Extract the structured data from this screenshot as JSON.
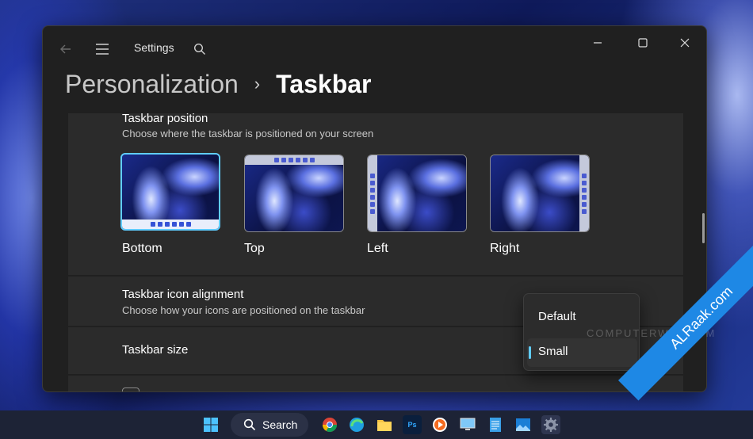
{
  "app": {
    "title": "Settings"
  },
  "breadcrumb": {
    "parent": "Personalization",
    "separator": "›",
    "current": "Taskbar"
  },
  "taskbar_position": {
    "title": "Taskbar position",
    "description": "Choose where the taskbar is positioned on your screen",
    "options": [
      {
        "label": "Bottom",
        "selected": true
      },
      {
        "label": "Top",
        "selected": false
      },
      {
        "label": "Left",
        "selected": false
      },
      {
        "label": "Right",
        "selected": false
      }
    ]
  },
  "icon_alignment": {
    "title": "Taskbar icon alignment",
    "description": "Choose how your icons are positioned on the taskbar"
  },
  "taskbar_size": {
    "title": "Taskbar size",
    "options": [
      {
        "label": "Default",
        "selected": false
      },
      {
        "label": "Small",
        "selected": true
      }
    ]
  },
  "watermark": "COMPUTERWID.COM",
  "ribbon": "ALRaak.com",
  "system_taskbar": {
    "search_label": "Search"
  },
  "colors": {
    "accent": "#60cdff",
    "window_bg": "#202020",
    "card_bg": "#2b2b2b",
    "ribbon": "#1e88e5"
  },
  "icons": {
    "back": "arrow-left-icon",
    "menu": "hamburger-icon",
    "search": "search-icon",
    "minimize": "minimize-icon",
    "maximize": "maximize-icon",
    "close": "close-icon"
  }
}
